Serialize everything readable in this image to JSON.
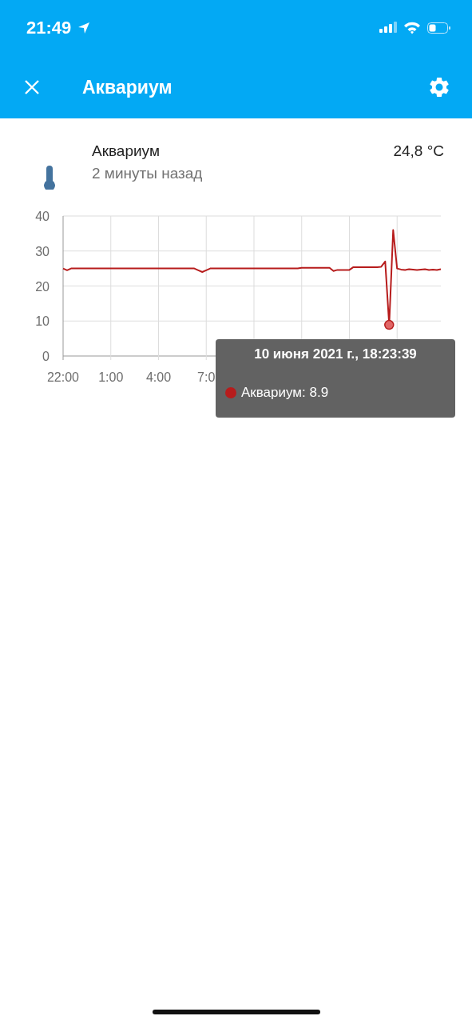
{
  "status_bar": {
    "time": "21:49"
  },
  "header": {
    "title": "Аквариум"
  },
  "sensor": {
    "name": "Аквариум",
    "updated": "2 минуты назад",
    "value": "24,8 °C"
  },
  "chart_data": {
    "type": "line",
    "categories": [
      "22:00",
      null,
      null,
      null,
      null,
      null,
      null,
      null,
      null,
      null,
      null,
      null,
      "1:00",
      null,
      null,
      null,
      null,
      null,
      null,
      null,
      null,
      null,
      null,
      null,
      "4:00",
      null,
      null,
      null,
      null,
      null,
      null,
      null,
      null,
      null,
      null,
      null,
      "7:0",
      null,
      null,
      null,
      null,
      null,
      null,
      null,
      null,
      null,
      null,
      null,
      null,
      null,
      null,
      null,
      null,
      null,
      null,
      null,
      null,
      null,
      null,
      null,
      null,
      null,
      null,
      null,
      null,
      null,
      null,
      null,
      null,
      null,
      null,
      null,
      null,
      null,
      null,
      null,
      null,
      null,
      null,
      null,
      null,
      null,
      null,
      null,
      null,
      null,
      null,
      null,
      null,
      null,
      null,
      null,
      null,
      null,
      null,
      null
    ],
    "series": [
      {
        "color": "#b71c1c",
        "values": [
          25,
          24.5,
          25,
          25,
          25,
          25,
          25,
          25,
          25,
          25,
          25,
          25,
          25,
          25,
          25,
          25,
          25,
          25,
          25,
          25,
          25,
          25,
          25,
          25,
          25,
          25,
          25,
          25,
          25,
          25,
          25,
          25,
          25,
          25,
          24.5,
          24,
          24.5,
          25,
          25,
          25,
          25,
          25,
          25,
          25,
          25,
          25,
          25,
          25,
          25,
          25,
          25,
          25,
          25,
          25,
          25,
          25,
          25,
          25,
          25,
          25,
          25.2,
          25.2,
          25.2,
          25.2,
          25.2,
          25.2,
          25.2,
          25.2,
          24.3,
          24.6,
          24.6,
          24.6,
          24.6,
          25.4,
          25.4,
          25.4,
          25.4,
          25.4,
          25.4,
          25.4,
          25.5,
          27,
          8.9,
          36,
          25,
          24.7,
          24.6,
          24.8,
          24.7,
          24.6,
          24.7,
          24.8,
          24.6,
          24.7,
          24.6,
          24.8
        ]
      }
    ],
    "ylim": [
      0,
      40
    ],
    "yticks": [
      0,
      10,
      20,
      30,
      40
    ],
    "grid": true
  },
  "tooltip": {
    "title": "10 июня 2021 г., 18:23:39",
    "text": "Аквариум: 8.9",
    "color": "#b71c1c"
  }
}
